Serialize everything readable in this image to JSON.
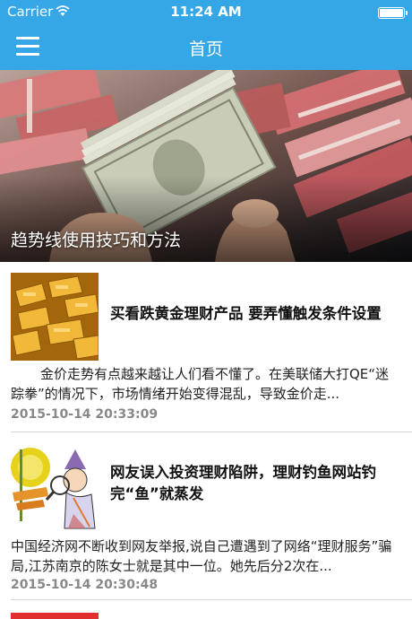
{
  "status_bar": {
    "carrier": "Carrier",
    "time": "11:24 AM"
  },
  "nav": {
    "title": "首页",
    "menu_icon": "hamburger-menu-icon"
  },
  "banner": {
    "caption": "趋势线使用技巧和方法"
  },
  "articles": [
    {
      "headline": "买看跌黄金理财产品 要弄懂触发条件设置",
      "summary": "金价走势有点越来越让人们看不懂了。在美联储大打QE“迷踪拳”的情况下，市场情绪开始变得混乱，导致金价走...",
      "time": "2015-10-14 20:33:09"
    },
    {
      "headline": "网友误入投资理财陷阱，理财钓鱼网站钓完“鱼”就蒸发",
      "summary": "中国经济网不断收到网友举报,说自己遭遇到了网络“理财服务”骗局,江苏南京的陈女士就是其中一位。她先后分2次在...",
      "time": "2015-10-14 20:30:48"
    }
  ],
  "colors": {
    "accent": "#35a7e6"
  }
}
